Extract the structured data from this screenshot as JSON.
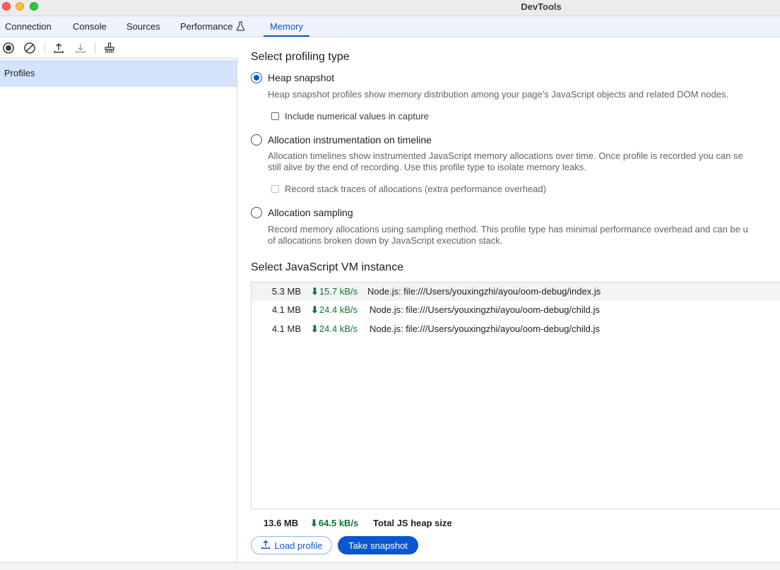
{
  "window": {
    "title": "DevTools"
  },
  "tabs": [
    {
      "label": "Connection"
    },
    {
      "label": "Console"
    },
    {
      "label": "Sources"
    },
    {
      "label": "Performance"
    },
    {
      "label": "Memory",
      "active": true
    }
  ],
  "toolbar": {
    "icons": [
      "record-icon",
      "clear-icon",
      "upload-icon",
      "download-icon",
      "garbage-collect-icon"
    ]
  },
  "sidebar": {
    "items": [
      {
        "label": "Profiles",
        "selected": true
      }
    ]
  },
  "profiling": {
    "heading": "Select profiling type",
    "options": [
      {
        "label": "Heap snapshot",
        "checked": true,
        "description": [
          "Heap snapshot profiles show memory distribution among your page's JavaScript objects and related DOM nodes."
        ],
        "checkbox": {
          "label": "Include numerical values in capture",
          "checked": false,
          "disabled": false
        }
      },
      {
        "label": "Allocation instrumentation on timeline",
        "checked": false,
        "description": [
          "Allocation timelines show instrumented JavaScript memory allocations over time. Once profile is recorded you can se",
          "still alive by the end of recording. Use this profile type to isolate memory leaks."
        ],
        "checkbox": {
          "label": "Record stack traces of allocations (extra performance overhead)",
          "checked": false,
          "disabled": true
        }
      },
      {
        "label": "Allocation sampling",
        "checked": false,
        "description": [
          "Record memory allocations using sampling method. This profile type has minimal performance overhead and can be u",
          "of allocations broken down by JavaScript execution stack."
        ]
      }
    ]
  },
  "vm": {
    "heading": "Select JavaScript VM instance",
    "instances": [
      {
        "size": "5.3 MB",
        "rate": "15.7 kB/s",
        "name": "Node.js: file:///Users/youxingzhi/ayou/oom-debug/index.js",
        "selected": true
      },
      {
        "size": "4.1 MB",
        "rate": "24.4 kB/s",
        "name": "Node.js: file:///Users/youxingzhi/ayou/oom-debug/child.js",
        "selected": false
      },
      {
        "size": "4.1 MB",
        "rate": "24.4 kB/s",
        "name": "Node.js: file:///Users/youxingzhi/ayou/oom-debug/child.js",
        "selected": false
      }
    ],
    "total": {
      "size": "13.6 MB",
      "rate": "64.5 kB/s",
      "label": "Total JS heap size"
    }
  },
  "actions": {
    "load_label": "Load profile",
    "snapshot_label": "Take snapshot"
  },
  "colors": {
    "accent": "#0b57d0",
    "rate_green": "#137333",
    "tab_bar": "#eef2fb",
    "sidebar_selected": "#d3e3fd"
  }
}
